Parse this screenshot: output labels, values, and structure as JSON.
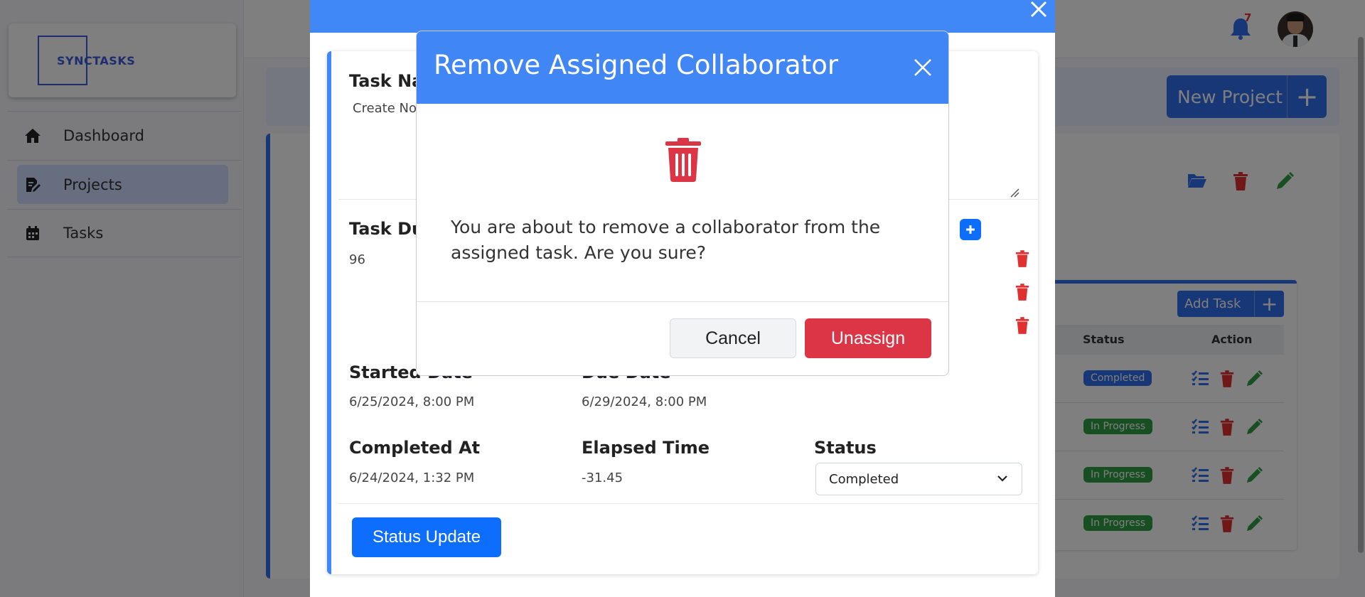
{
  "app": {
    "logo_text": "SYNCTASKS",
    "notification_count": "7"
  },
  "sidebar": {
    "items": [
      {
        "label": "Dashboard",
        "icon": "home-icon"
      },
      {
        "label": "Projects",
        "icon": "edit-document-icon"
      },
      {
        "label": "Tasks",
        "icon": "calendar-icon"
      }
    ]
  },
  "project": {
    "new_project_label": "New Project",
    "add_task_label": "Add Task",
    "table_headers": {
      "status": "Status",
      "action": "Action"
    },
    "rows": [
      {
        "status": "Completed",
        "status_kind": "completed"
      },
      {
        "status": "In Progress",
        "status_kind": "progress"
      },
      {
        "status": "In Progress",
        "status_kind": "progress"
      },
      {
        "status": "In Progress",
        "status_kind": "progress"
      }
    ]
  },
  "task_modal": {
    "task_name_label": "Task Na",
    "task_name_value": "Create No",
    "task_duration_label": "Task Du",
    "task_duration_value": "96",
    "started_label": "Started Date",
    "started_value": "6/25/2024, 8:00 PM",
    "due_label": "Due Date",
    "due_value": "6/29/2024, 8:00 PM",
    "completed_label": "Completed At",
    "completed_value": "6/24/2024, 1:32 PM",
    "elapsed_label": "Elapsed Time",
    "elapsed_value": "-31.45",
    "status_label": "Status",
    "status_value": "Completed",
    "status_update_label": "Status Update"
  },
  "confirm": {
    "title": "Remove Assigned Collaborator",
    "message": "You are about to remove a collaborator from the assigned task. Are you sure?",
    "cancel_label": "Cancel",
    "unassign_label": "Unassign"
  },
  "colors": {
    "primary": "#0d6efd",
    "header_blue": "#4086f4",
    "danger": "#dc3545",
    "success": "#2f9e44"
  }
}
